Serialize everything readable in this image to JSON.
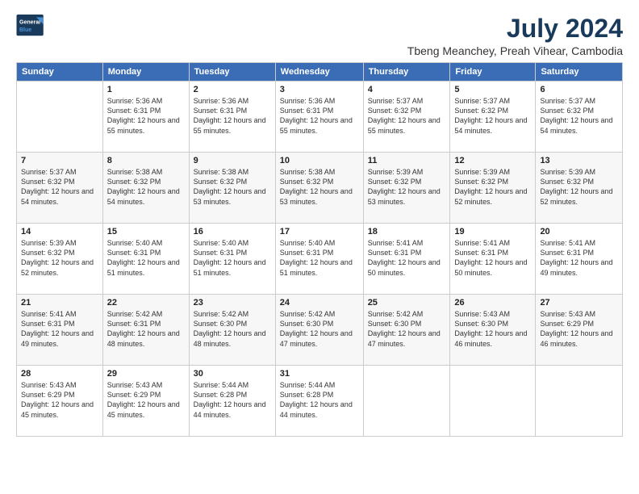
{
  "logo": {
    "line1": "General",
    "line2": "Blue"
  },
  "title": "July 2024",
  "location": "Tbeng Meanchey, Preah Vihear, Cambodia",
  "weekdays": [
    "Sunday",
    "Monday",
    "Tuesday",
    "Wednesday",
    "Thursday",
    "Friday",
    "Saturday"
  ],
  "weeks": [
    [
      {
        "day": "",
        "sunrise": "",
        "sunset": "",
        "daylight": ""
      },
      {
        "day": "1",
        "sunrise": "Sunrise: 5:36 AM",
        "sunset": "Sunset: 6:31 PM",
        "daylight": "Daylight: 12 hours and 55 minutes."
      },
      {
        "day": "2",
        "sunrise": "Sunrise: 5:36 AM",
        "sunset": "Sunset: 6:31 PM",
        "daylight": "Daylight: 12 hours and 55 minutes."
      },
      {
        "day": "3",
        "sunrise": "Sunrise: 5:36 AM",
        "sunset": "Sunset: 6:31 PM",
        "daylight": "Daylight: 12 hours and 55 minutes."
      },
      {
        "day": "4",
        "sunrise": "Sunrise: 5:37 AM",
        "sunset": "Sunset: 6:32 PM",
        "daylight": "Daylight: 12 hours and 55 minutes."
      },
      {
        "day": "5",
        "sunrise": "Sunrise: 5:37 AM",
        "sunset": "Sunset: 6:32 PM",
        "daylight": "Daylight: 12 hours and 54 minutes."
      },
      {
        "day": "6",
        "sunrise": "Sunrise: 5:37 AM",
        "sunset": "Sunset: 6:32 PM",
        "daylight": "Daylight: 12 hours and 54 minutes."
      }
    ],
    [
      {
        "day": "7",
        "sunrise": "Sunrise: 5:37 AM",
        "sunset": "Sunset: 6:32 PM",
        "daylight": "Daylight: 12 hours and 54 minutes."
      },
      {
        "day": "8",
        "sunrise": "Sunrise: 5:38 AM",
        "sunset": "Sunset: 6:32 PM",
        "daylight": "Daylight: 12 hours and 54 minutes."
      },
      {
        "day": "9",
        "sunrise": "Sunrise: 5:38 AM",
        "sunset": "Sunset: 6:32 PM",
        "daylight": "Daylight: 12 hours and 53 minutes."
      },
      {
        "day": "10",
        "sunrise": "Sunrise: 5:38 AM",
        "sunset": "Sunset: 6:32 PM",
        "daylight": "Daylight: 12 hours and 53 minutes."
      },
      {
        "day": "11",
        "sunrise": "Sunrise: 5:39 AM",
        "sunset": "Sunset: 6:32 PM",
        "daylight": "Daylight: 12 hours and 53 minutes."
      },
      {
        "day": "12",
        "sunrise": "Sunrise: 5:39 AM",
        "sunset": "Sunset: 6:32 PM",
        "daylight": "Daylight: 12 hours and 52 minutes."
      },
      {
        "day": "13",
        "sunrise": "Sunrise: 5:39 AM",
        "sunset": "Sunset: 6:32 PM",
        "daylight": "Daylight: 12 hours and 52 minutes."
      }
    ],
    [
      {
        "day": "14",
        "sunrise": "Sunrise: 5:39 AM",
        "sunset": "Sunset: 6:32 PM",
        "daylight": "Daylight: 12 hours and 52 minutes."
      },
      {
        "day": "15",
        "sunrise": "Sunrise: 5:40 AM",
        "sunset": "Sunset: 6:31 PM",
        "daylight": "Daylight: 12 hours and 51 minutes."
      },
      {
        "day": "16",
        "sunrise": "Sunrise: 5:40 AM",
        "sunset": "Sunset: 6:31 PM",
        "daylight": "Daylight: 12 hours and 51 minutes."
      },
      {
        "day": "17",
        "sunrise": "Sunrise: 5:40 AM",
        "sunset": "Sunset: 6:31 PM",
        "daylight": "Daylight: 12 hours and 51 minutes."
      },
      {
        "day": "18",
        "sunrise": "Sunrise: 5:41 AM",
        "sunset": "Sunset: 6:31 PM",
        "daylight": "Daylight: 12 hours and 50 minutes."
      },
      {
        "day": "19",
        "sunrise": "Sunrise: 5:41 AM",
        "sunset": "Sunset: 6:31 PM",
        "daylight": "Daylight: 12 hours and 50 minutes."
      },
      {
        "day": "20",
        "sunrise": "Sunrise: 5:41 AM",
        "sunset": "Sunset: 6:31 PM",
        "daylight": "Daylight: 12 hours and 49 minutes."
      }
    ],
    [
      {
        "day": "21",
        "sunrise": "Sunrise: 5:41 AM",
        "sunset": "Sunset: 6:31 PM",
        "daylight": "Daylight: 12 hours and 49 minutes."
      },
      {
        "day": "22",
        "sunrise": "Sunrise: 5:42 AM",
        "sunset": "Sunset: 6:31 PM",
        "daylight": "Daylight: 12 hours and 48 minutes."
      },
      {
        "day": "23",
        "sunrise": "Sunrise: 5:42 AM",
        "sunset": "Sunset: 6:30 PM",
        "daylight": "Daylight: 12 hours and 48 minutes."
      },
      {
        "day": "24",
        "sunrise": "Sunrise: 5:42 AM",
        "sunset": "Sunset: 6:30 PM",
        "daylight": "Daylight: 12 hours and 47 minutes."
      },
      {
        "day": "25",
        "sunrise": "Sunrise: 5:42 AM",
        "sunset": "Sunset: 6:30 PM",
        "daylight": "Daylight: 12 hours and 47 minutes."
      },
      {
        "day": "26",
        "sunrise": "Sunrise: 5:43 AM",
        "sunset": "Sunset: 6:30 PM",
        "daylight": "Daylight: 12 hours and 46 minutes."
      },
      {
        "day": "27",
        "sunrise": "Sunrise: 5:43 AM",
        "sunset": "Sunset: 6:29 PM",
        "daylight": "Daylight: 12 hours and 46 minutes."
      }
    ],
    [
      {
        "day": "28",
        "sunrise": "Sunrise: 5:43 AM",
        "sunset": "Sunset: 6:29 PM",
        "daylight": "Daylight: 12 hours and 45 minutes."
      },
      {
        "day": "29",
        "sunrise": "Sunrise: 5:43 AM",
        "sunset": "Sunset: 6:29 PM",
        "daylight": "Daylight: 12 hours and 45 minutes."
      },
      {
        "day": "30",
        "sunrise": "Sunrise: 5:44 AM",
        "sunset": "Sunset: 6:28 PM",
        "daylight": "Daylight: 12 hours and 44 minutes."
      },
      {
        "day": "31",
        "sunrise": "Sunrise: 5:44 AM",
        "sunset": "Sunset: 6:28 PM",
        "daylight": "Daylight: 12 hours and 44 minutes."
      },
      {
        "day": "",
        "sunrise": "",
        "sunset": "",
        "daylight": ""
      },
      {
        "day": "",
        "sunrise": "",
        "sunset": "",
        "daylight": ""
      },
      {
        "day": "",
        "sunrise": "",
        "sunset": "",
        "daylight": ""
      }
    ]
  ]
}
